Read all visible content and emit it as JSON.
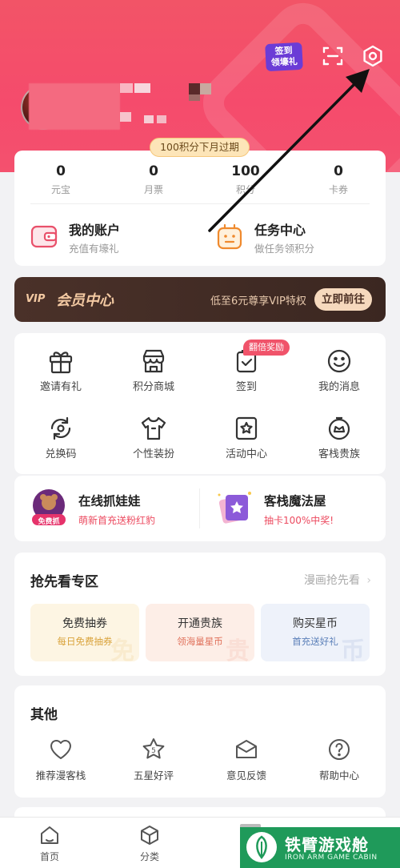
{
  "header": {
    "checkin_line1": "签到",
    "checkin_line2": "领壕礼"
  },
  "stats": {
    "expire_notice": "100积分下月过期",
    "items": [
      {
        "value": "0",
        "label": "元宝"
      },
      {
        "value": "0",
        "label": "月票"
      },
      {
        "value": "100",
        "label": "积分"
      },
      {
        "value": "0",
        "label": "卡券"
      }
    ]
  },
  "account": {
    "title": "我的账户",
    "subtitle": "充值有壕礼"
  },
  "tasks": {
    "title": "任务中心",
    "subtitle": "做任务领积分"
  },
  "vip": {
    "logo": "VIP",
    "title": "会员中心",
    "desc": "低至6元尊享VIP特权",
    "button": "立即前往"
  },
  "grid": {
    "bonus_tag": "翻倍奖励",
    "items": [
      {
        "label": "邀请有礼",
        "icon": "gift-icon"
      },
      {
        "label": "积分商城",
        "icon": "store-icon"
      },
      {
        "label": "签到",
        "icon": "checkin-icon"
      },
      {
        "label": "我的消息",
        "icon": "message-icon"
      },
      {
        "label": "兑换码",
        "icon": "redeem-icon"
      },
      {
        "label": "个性装扮",
        "icon": "outfit-icon"
      },
      {
        "label": "活动中心",
        "icon": "activity-icon"
      },
      {
        "label": "客栈贵族",
        "icon": "noble-icon"
      }
    ]
  },
  "promos": [
    {
      "title": "在线抓娃娃",
      "subtitle": "萌新首充送粉红豹",
      "badge": "免费抓"
    },
    {
      "title": "客栈魔法屋",
      "subtitle": "抽卡100%中奖!"
    }
  ],
  "first_look": {
    "title": "抢先看专区",
    "more": "漫画抢先看",
    "tiles": [
      {
        "title": "免费抽券",
        "subtitle": "每日免费抽券",
        "mark": "免",
        "color": "#d9a23a"
      },
      {
        "title": "开通贵族",
        "subtitle": "领海量星币",
        "mark": "贵",
        "color": "#e0705a"
      },
      {
        "title": "购买星币",
        "subtitle": "首充送好礼",
        "mark": "币",
        "color": "#5a7fb8"
      }
    ]
  },
  "other": {
    "title": "其他",
    "items": [
      {
        "label": "推荐漫客栈",
        "icon": "heart-icon"
      },
      {
        "label": "五星好评",
        "icon": "star-icon"
      },
      {
        "label": "意见反馈",
        "icon": "feedback-icon"
      },
      {
        "label": "帮助中心",
        "icon": "help-icon"
      }
    ]
  },
  "tabbar": {
    "items": [
      {
        "label": "首页",
        "icon": "home-icon"
      },
      {
        "label": "分类",
        "icon": "category-icon"
      }
    ]
  },
  "watermark": {
    "title": "铁臂游戏舱",
    "subtitle": "IRON ARM GAME CABIN"
  }
}
